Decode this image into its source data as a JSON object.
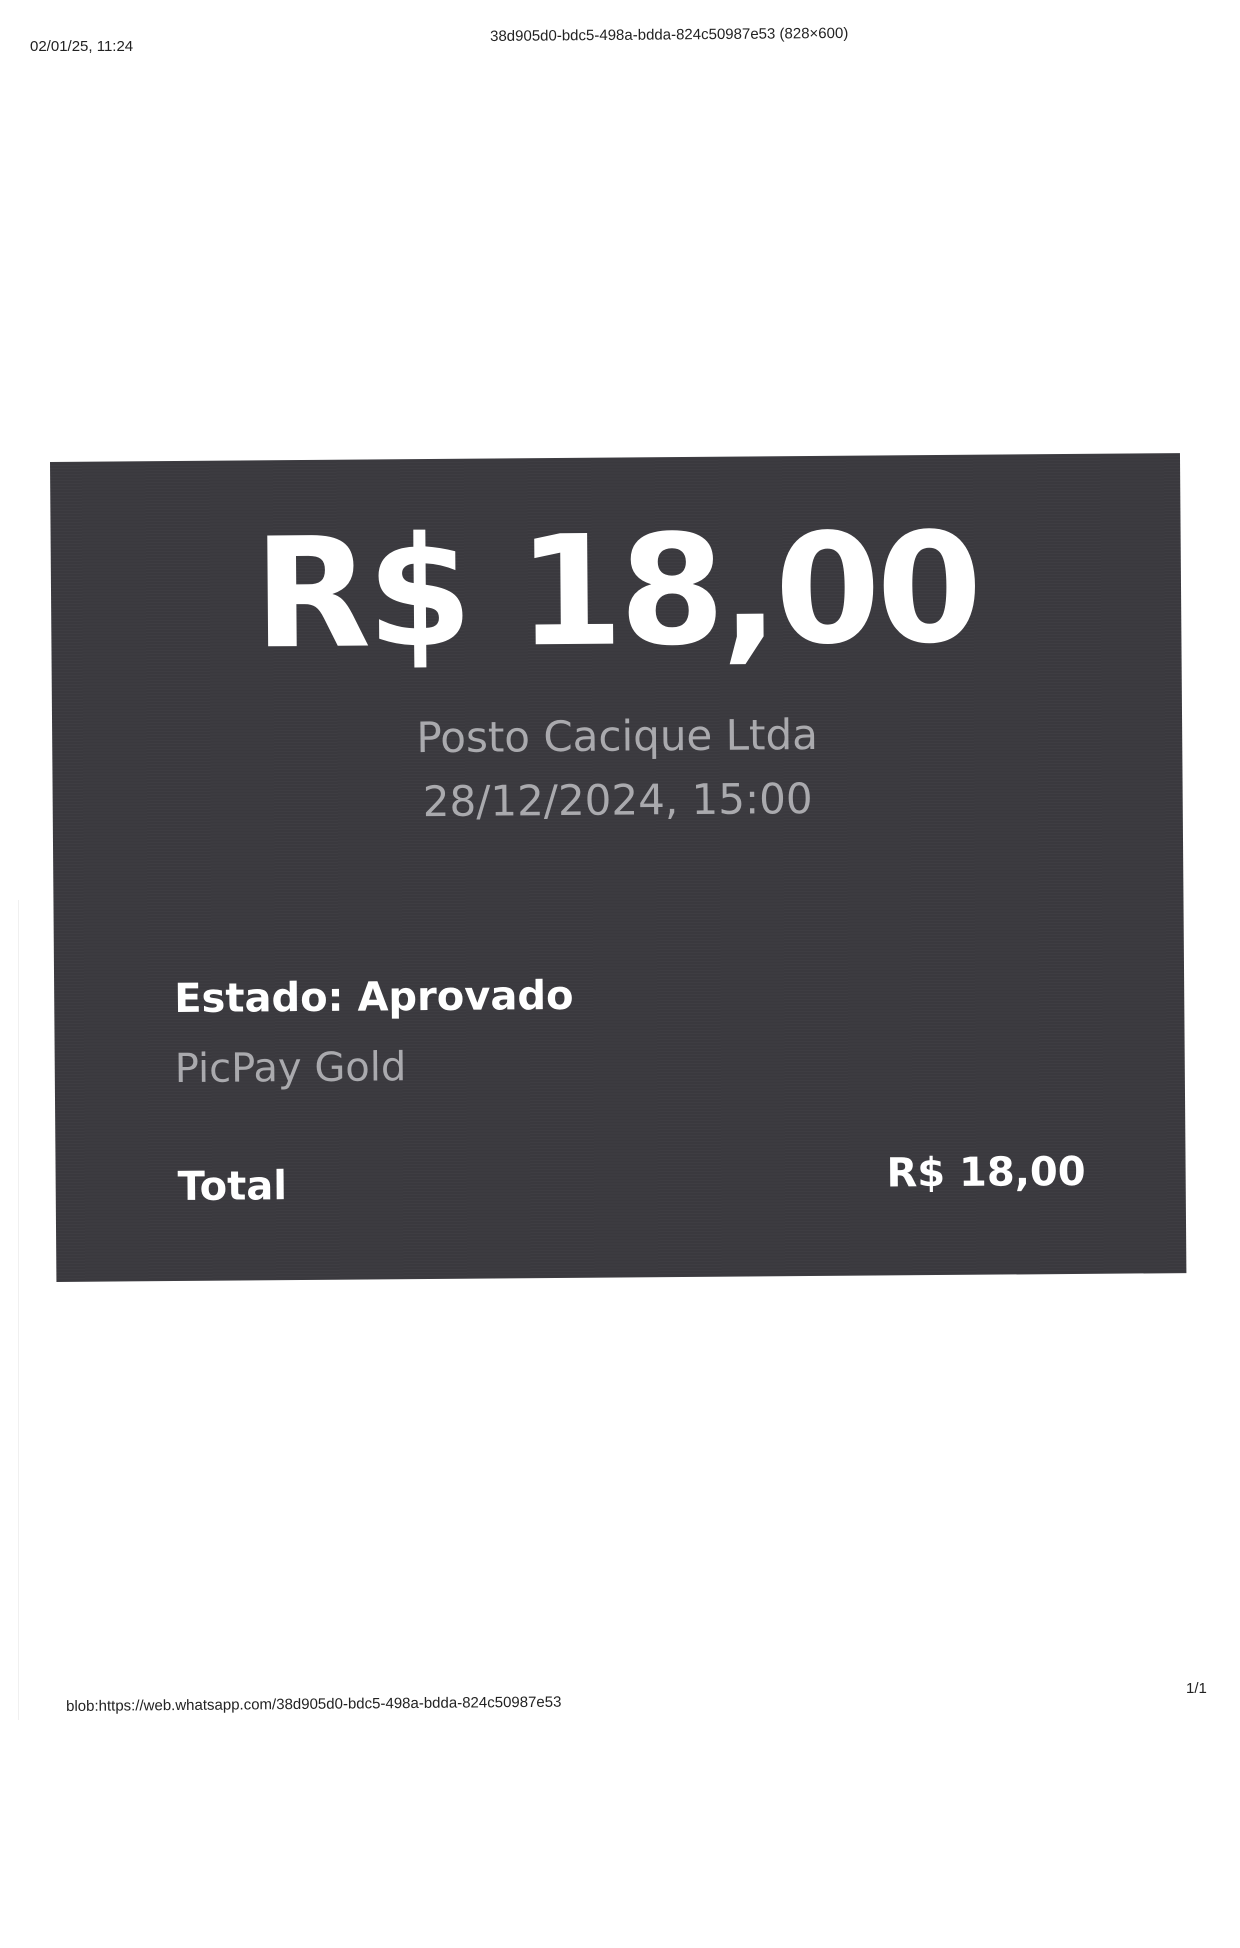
{
  "print_header": {
    "datetime": "02/01/25, 11:24",
    "title": "38d905d0-bdc5-498a-bdda-824c50987e53 (828×600)"
  },
  "receipt": {
    "amount": "R$ 18,00",
    "merchant": "Posto Cacique Ltda",
    "datetime": "28/12/2024, 15:00",
    "status": "Estado: Aprovado",
    "card_name": "PicPay Gold",
    "total_label": "Total",
    "total_value": "R$ 18,00",
    "background_color": "#3a393e",
    "primary_text_color": "#ffffff",
    "secondary_text_color": "#a9a9ad"
  },
  "print_footer": {
    "url": "blob:https://web.whatsapp.com/38d905d0-bdc5-498a-bdda-824c50987e53",
    "page": "1/1"
  }
}
